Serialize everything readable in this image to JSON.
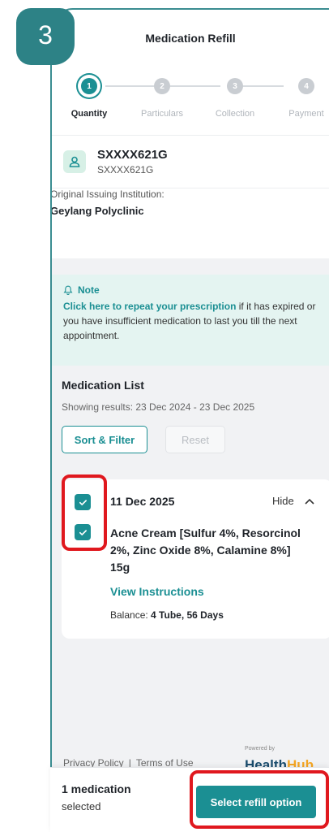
{
  "step_badge": "3",
  "header": {
    "title": "Medication Refill"
  },
  "stepper": [
    {
      "num": "1",
      "label": "Quantity"
    },
    {
      "num": "2",
      "label": "Particulars"
    },
    {
      "num": "3",
      "label": "Collection"
    },
    {
      "num": "4",
      "label": "Payment"
    }
  ],
  "patient": {
    "id_bold": "SXXXX621G",
    "id_sub": "SXXXX621G",
    "icon": "user-icon"
  },
  "institution": {
    "label": "Original Issuing Institution:",
    "name": "Geylang Polyclinic"
  },
  "note": {
    "title": "Note",
    "link_text": "Click here to repeat your prescription",
    "rest_text": " if it has expired or you have insufficient medication to last you till the next appointment.",
    "icon": "bell-icon"
  },
  "medication_list": {
    "title": "Medication List",
    "subtitle": "Showing results: 23 Dec 2024 - 23 Dec 2025",
    "sort_label": "Sort & Filter",
    "reset_label": "Reset"
  },
  "card": {
    "date": "11 Dec 2025",
    "hide_label": "Hide",
    "medication": "Acne Cream [Sulfur 4%, Resorcinol 2%, Zinc Oxide 8%, Calamine 8%] 15g",
    "view_instructions": "View Instructions",
    "balance_label": "Balance:",
    "balance_value": "4 Tube, 56 Days",
    "date_checked": true,
    "med_checked": true
  },
  "footer": {
    "privacy": "Privacy Policy",
    "separator": "|",
    "terms": "Terms of Use",
    "powered_by": "Powered by",
    "logo_part1": "Health",
    "logo_part2": "Hub"
  },
  "bottom_bar": {
    "count_line1": "1 medication",
    "count_line2": "selected",
    "button_label": "Select refill option"
  },
  "colors": {
    "primary": "#1b8f93",
    "badge": "#2d8286",
    "highlight": "#e0181e",
    "note_bg": "#e4f4f1"
  }
}
